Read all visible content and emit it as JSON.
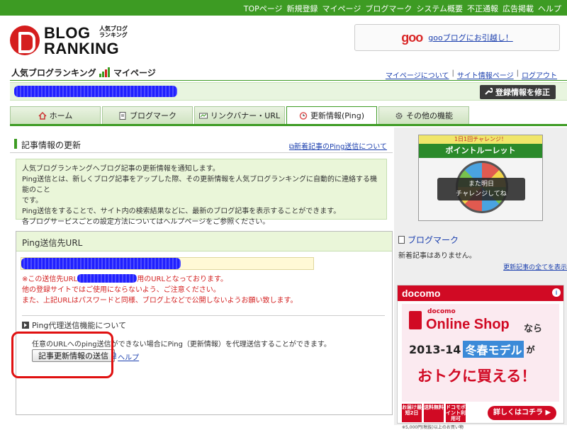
{
  "topnav": {
    "links": [
      "TOPページ",
      "新規登録",
      "マイページ",
      "ブログマーク",
      "システム概要",
      "不正通報",
      "広告掲載",
      "ヘルプ"
    ]
  },
  "logo": {
    "line1": "BLOG",
    "line2": "RANKING",
    "sub": "人気ブログランキング"
  },
  "goo": {
    "logo": "goo",
    "link": "gooブログにお引越し！"
  },
  "titlebar": {
    "title_prefix": "人気ブログランキング",
    "title_suffix": "マイページ",
    "links": [
      "マイページについて",
      "サイト情報ページ",
      "ログアウト"
    ],
    "separator": "|"
  },
  "userbar": {
    "edit_button": "登録情報を修正"
  },
  "tabs": [
    {
      "label": "ホーム",
      "icon": "house-icon"
    },
    {
      "label": "ブログマーク",
      "icon": "document-icon"
    },
    {
      "label": "リンクバナー・URL",
      "icon": "banner-icon"
    },
    {
      "label": "更新情報(Ping)",
      "icon": "clock-icon",
      "active": true
    },
    {
      "label": "その他の機能",
      "icon": "gear-icon"
    }
  ],
  "main": {
    "section_title": "記事情報の更新",
    "section_link": "新着記事のPing送信について",
    "info_lines": [
      "人気ブログランキングへブログ記事の更新情報を通知します。",
      "Ping送信とは、新しくブログ記事をアップした際、その更新情報を人気ブログランキングに自動的に連絡する機能のこと",
      "です。",
      "Ping送信をすることで、サイト内の検索結果などに、最新のブログ記事を表示することができます。",
      "各ブログサービスごとの設定方法についてはヘルプページをご参照ください。"
    ],
    "ping": {
      "header": "Ping送信先URL",
      "note1_a": "※この送信先URL",
      "note1_b": "用のURLとなっております。",
      "note2": "他の登録サイトではご使用にならないよう、ご注意ください。",
      "note3": "また、上記URLはパスワードと同様、ブログ上などで公開しないようお願い致します。",
      "proxy_title": "Ping代理送信機能について",
      "proxy_desc": "任意のURLへのping送信ができない場合にPing（更新情報）を代理送信することができます。",
      "send_button": "記事更新情報の送信",
      "help": "ヘルプ"
    }
  },
  "right": {
    "roulette_top": "1日1回チャレンジ！",
    "roulette_title": "ポイントルーレット",
    "roulette_overlay_1": "また明日",
    "roulette_overlay_2": "チャレンジしてね",
    "bookmark_title": "ブログマーク",
    "bookmark_text": "新着記事はありません。",
    "bookmark_link": "更新記事の全てを表示",
    "ad": {
      "brand": "docomo",
      "docomo_small": "docomo",
      "shop": "Online Shop",
      "nara": "なら",
      "season": "2013-14",
      "highlight": "冬春モデル",
      "ga": "が",
      "catch": "おトクに買える！",
      "chips": [
        "お届け最短2日",
        "送料無料",
        "ドコモポイント利用可"
      ],
      "more": "詳しくはコチラ ▶",
      "footnote": "※5,000円(税抜)以上のお買い物"
    }
  }
}
